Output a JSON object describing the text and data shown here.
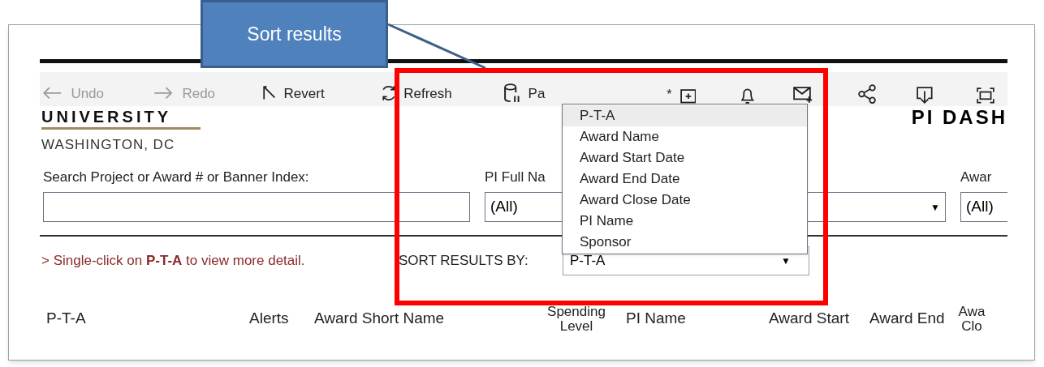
{
  "callout": {
    "text": "Sort results"
  },
  "toolbar": {
    "items": [
      {
        "kind": "undo",
        "label": "Undo",
        "disabled": true
      },
      {
        "kind": "redo",
        "label": "Redo",
        "disabled": true
      },
      {
        "kind": "revert",
        "label": "Revert",
        "disabled": false
      },
      {
        "kind": "refresh",
        "label": "Refresh",
        "disabled": false
      },
      {
        "kind": "pause",
        "label": "Pa",
        "disabled": false
      },
      {
        "kind": "custom-view",
        "label": "*",
        "disabled": false
      },
      {
        "kind": "alert",
        "disabled": false
      },
      {
        "kind": "subscribe",
        "disabled": false
      },
      {
        "kind": "share",
        "disabled": false
      },
      {
        "kind": "download",
        "disabled": false
      },
      {
        "kind": "fullscreen",
        "disabled": false
      }
    ]
  },
  "logo": {
    "line_1": "UNIVERSITY",
    "line_2": "WASHINGTON, DC"
  },
  "dashboard_title": "PI DASH",
  "filters": [
    {
      "kind": "text",
      "label": "Search Project or Award # or Banner Index:"
    },
    {
      "kind": "select",
      "label": "PI Full Na",
      "value": "(All)",
      "caret": "▼"
    },
    {
      "kind": "select",
      "label": "Awar",
      "value": "(All)"
    }
  ],
  "note": "> Single-click on **P-T-A** to view more detail.",
  "sort": {
    "label": "SORT RESULTS BY:",
    "value": "P-T-A",
    "caret": "▼",
    "options": [
      {
        "label": "P-T-A",
        "selected": true
      },
      {
        "label": "Award Name",
        "selected": false
      },
      {
        "label": "Award Start Date",
        "selected": false
      },
      {
        "label": "Award End Date",
        "selected": false
      },
      {
        "label": "Award Close Date",
        "selected": false
      },
      {
        "label": "PI Name",
        "selected": false
      },
      {
        "label": "Sponsor",
        "selected": false
      }
    ]
  },
  "table": {
    "columns": [
      "P-T-A",
      "Alerts",
      "Award Short Name",
      "Spending Level",
      "PI Name",
      "Award Start",
      "Award End",
      "Awa Clo"
    ]
  }
}
